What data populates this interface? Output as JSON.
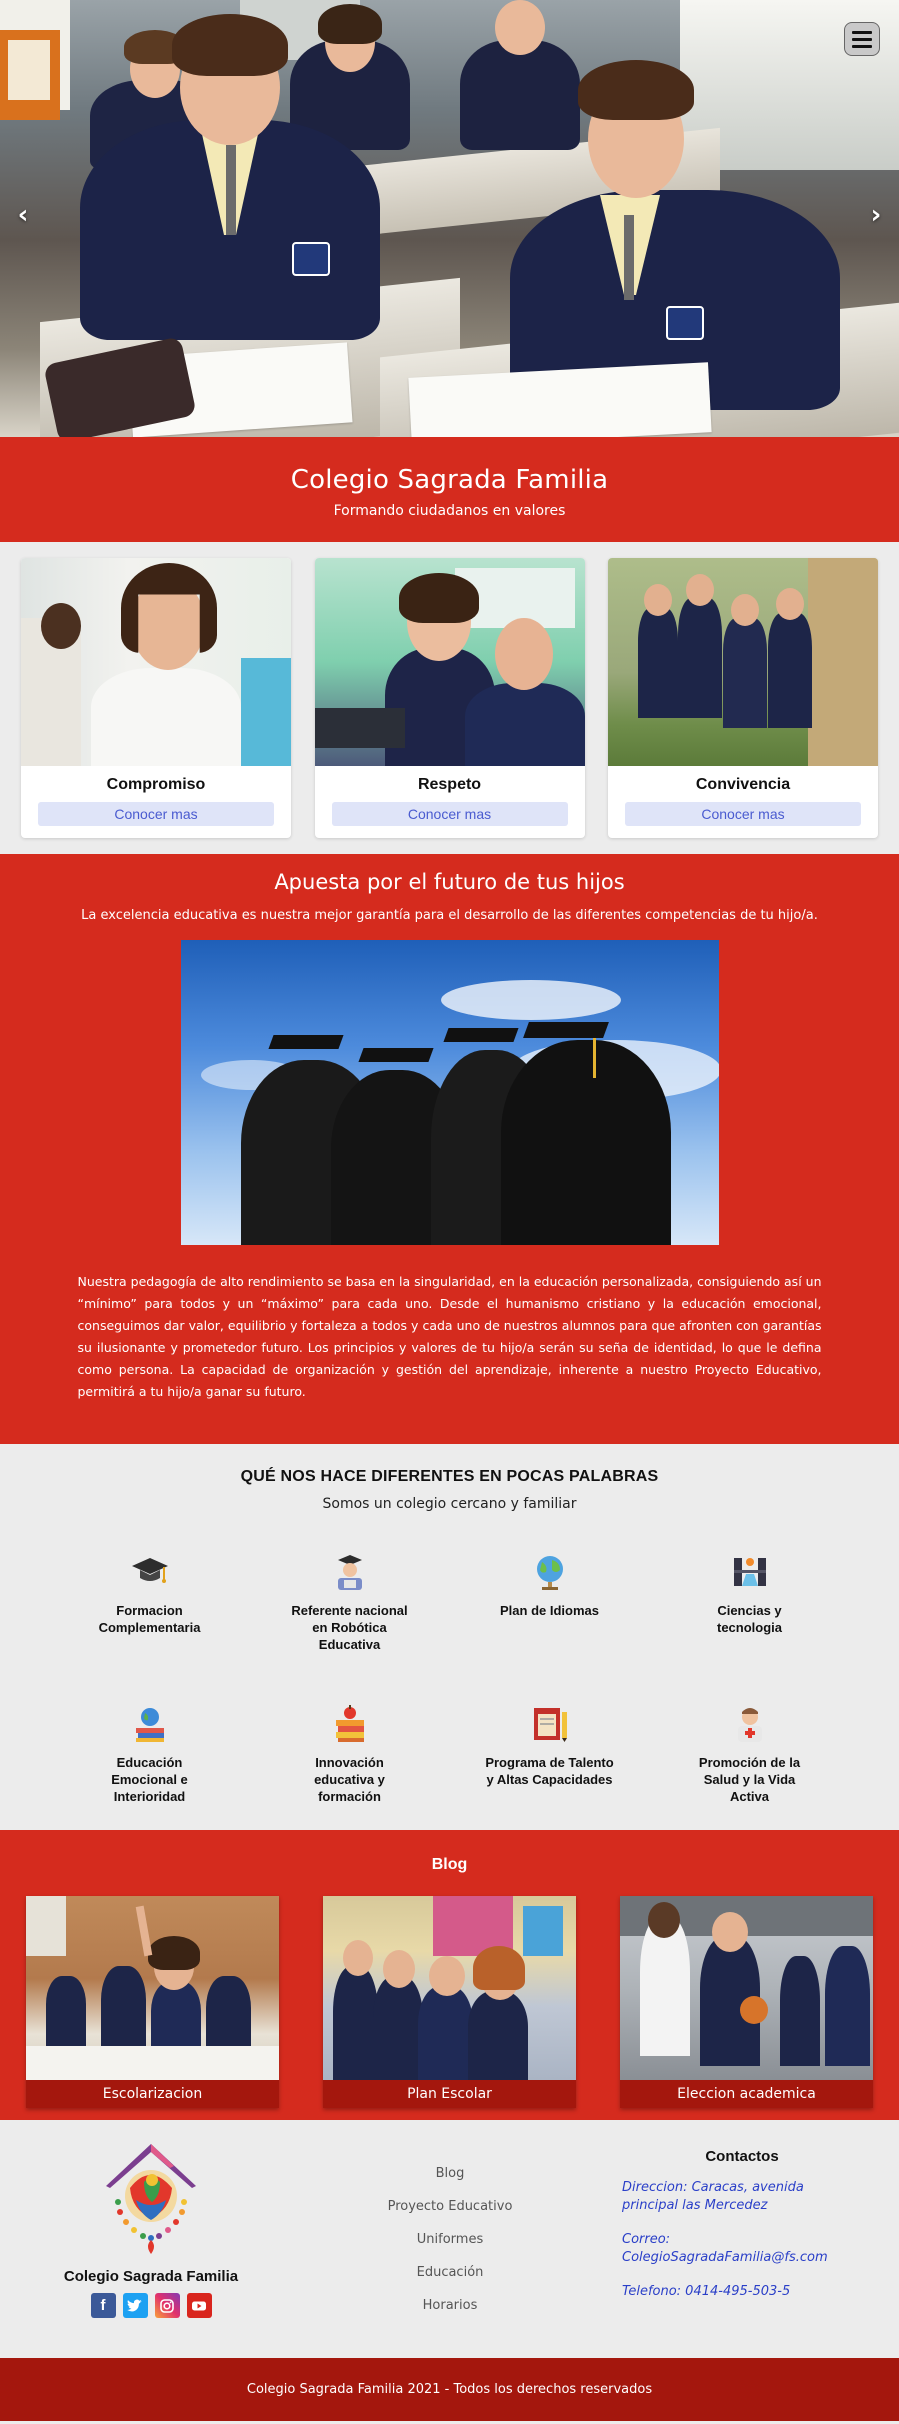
{
  "hero": {
    "arrow_left": "‹",
    "arrow_right": "›",
    "menu_icon": "hamburger-icon"
  },
  "banner": {
    "title": "Colegio Sagrada Familia",
    "subtitle": "Formando ciudadanos en valores"
  },
  "values": [
    {
      "title": "Compromiso",
      "button": "Conocer mas"
    },
    {
      "title": "Respeto",
      "button": "Conocer mas"
    },
    {
      "title": "Convivencia",
      "button": "Conocer mas"
    }
  ],
  "apuesta": {
    "title": "Apuesta por el futuro de tus hijos",
    "lead": "La excelencia educativa es nuestra mejor garantía para el desarrollo de las diferentes competencias de tu hijo/a.",
    "body": "Nuestra pedagogía de alto rendimiento se basa en la singularidad, en la educación personalizada, consiguiendo así un “mínimo” para todos y un “máximo” para cada uno. Desde el humanismo cristiano y la educación emocional, conseguimos dar valor, equilibrio y fortaleza a todos y cada uno de nuestros alumnos para que afronten con garantías su ilusionante y prometedor futuro. Los principios y valores de tu hijo/a serán su seña de identidad, lo que le defina como persona. La capacidad de organización y gestión del aprendizaje, inherente a nuestro Proyecto Educativo, permitirá a tu hijo/a ganar su futuro."
  },
  "diferentes": {
    "title": "QUÉ NOS HACE DIFERENTES EN POCAS PALABRAS",
    "subtitle": "Somos un colegio cercano y familiar",
    "features": [
      {
        "label": "Formacion Complementaria",
        "icon": "graduation-cap-icon"
      },
      {
        "label": "Referente nacional en Robótica Educativa",
        "icon": "teacher-robot-icon"
      },
      {
        "label": "Plan de Idiomas",
        "icon": "globe-icon"
      },
      {
        "label": "Ciencias y tecnologia",
        "icon": "science-lab-icon"
      },
      {
        "label": "Educación Emocional e Interioridad",
        "icon": "globe-books-icon"
      },
      {
        "label": "Innovación educativa y formación",
        "icon": "books-apple-icon"
      },
      {
        "label": "Programa de Talento y Altas Capacidades",
        "icon": "planner-pencil-icon"
      },
      {
        "label": "Promoción de la Salud y la Vida Activa",
        "icon": "doctor-icon"
      }
    ]
  },
  "blog": {
    "title": "Blog",
    "posts": [
      {
        "caption": "Escolarizacion"
      },
      {
        "caption": "Plan Escolar"
      },
      {
        "caption": "Eleccion academica"
      }
    ]
  },
  "footer": {
    "brand": "Colegio Sagrada Familia",
    "social": [
      "facebook-icon",
      "twitter-icon",
      "instagram-icon",
      "youtube-icon"
    ],
    "links": [
      "Blog",
      "Proyecto Educativo",
      "Uniformes",
      "Educación",
      "Horarios"
    ],
    "contact_title": "Contactos",
    "address": "Direccion: Caracas, avenida principal las Mercedez",
    "email": "Correo: ColegioSagradaFamilia@fs.com",
    "phone": "Telefono: 0414-495-503-5",
    "copyright": "Colegio Sagrada Familia 2021 - Todos los derechos reservados"
  },
  "colors": {
    "primary_red": "#d52b1e",
    "dark_red": "#a4170d",
    "light_bg": "#ececec",
    "button_bg": "#dfe4f8",
    "link_blue": "#2a3fc8"
  }
}
